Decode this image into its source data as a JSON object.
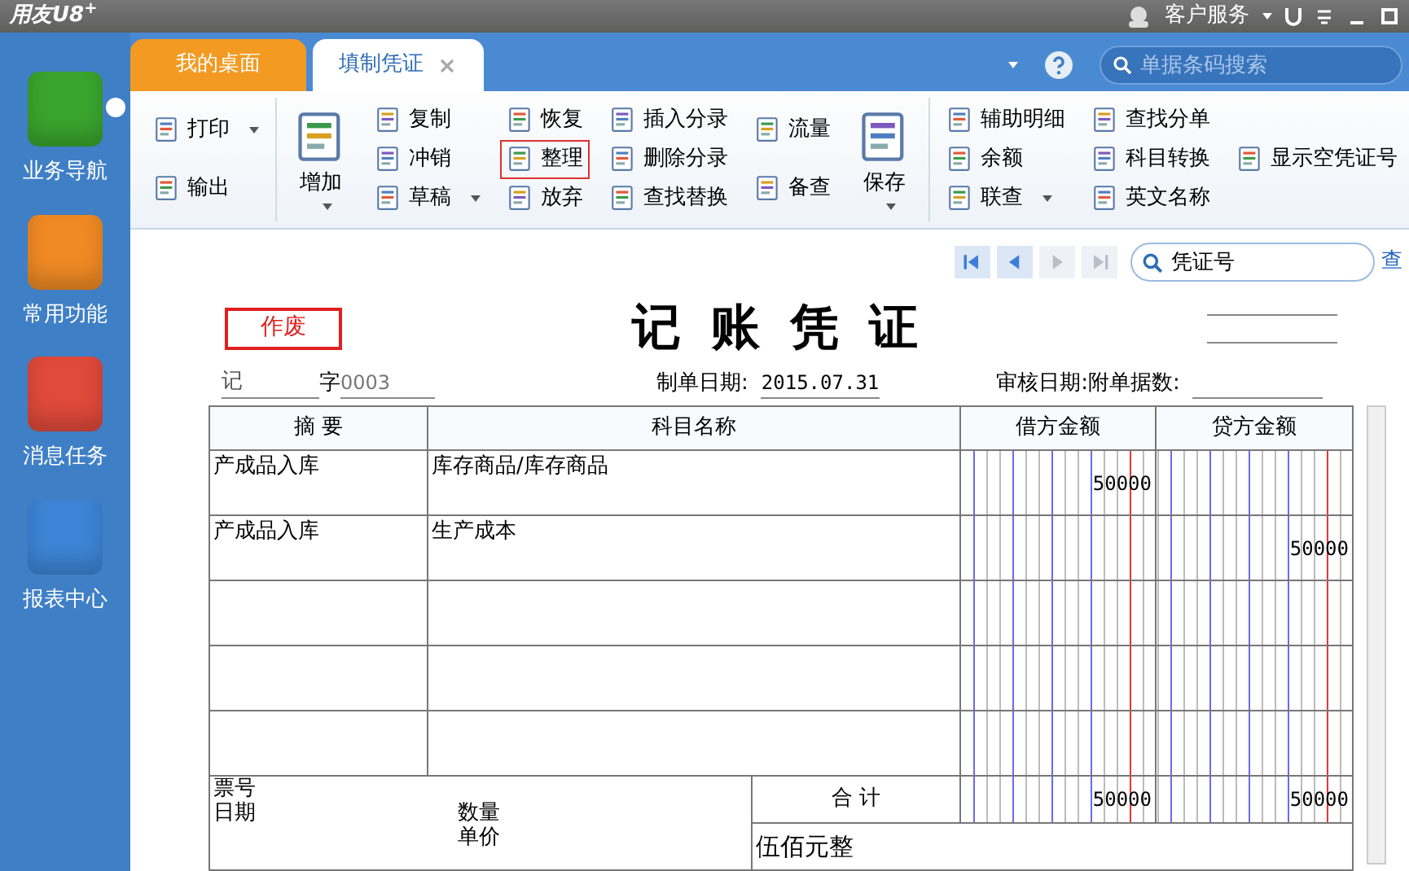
{
  "app_title": "用友U8$^{+}$",
  "title_bar": {
    "service_label": "客户服务"
  },
  "sidebar": {
    "items": [
      {
        "label": "业务导航",
        "color": "#3aa52e",
        "dropdown": true
      },
      {
        "label": "常用功能",
        "color": "#f08a24",
        "dropdown": false
      },
      {
        "label": "消息任务",
        "color": "#e04a3a",
        "dropdown": false
      },
      {
        "label": "报表中心",
        "color": "#3d85d6",
        "dropdown": false
      }
    ]
  },
  "tabs": [
    {
      "label": "我的桌面",
      "selected": false,
      "closable": false
    },
    {
      "label": "填制凭证",
      "selected": true,
      "closable": true
    }
  ],
  "search": {
    "placeholder": "单据条码搜索"
  },
  "toolbar": {
    "groups": [
      {
        "columns": [
          {
            "kind": "stack",
            "items": [
              {
                "label": "打印",
                "dropdown": true,
                "highlighted": false
              },
              {
                "label": "输出",
                "dropdown": false,
                "highlighted": false
              }
            ]
          }
        ]
      },
      {
        "columns": [
          {
            "kind": "large",
            "items": [
              {
                "label": "增加",
                "dropdown": true,
                "highlighted": false
              }
            ]
          },
          {
            "kind": "stack",
            "items": [
              {
                "label": "复制",
                "dropdown": false,
                "highlighted": false
              },
              {
                "label": "冲销",
                "dropdown": false,
                "highlighted": false
              },
              {
                "label": "草稿",
                "dropdown": true,
                "highlighted": false
              }
            ]
          },
          {
            "kind": "stack",
            "items": [
              {
                "label": "恢复",
                "dropdown": false,
                "highlighted": false
              },
              {
                "label": "整理",
                "dropdown": false,
                "highlighted": true
              },
              {
                "label": "放弃",
                "dropdown": false,
                "highlighted": false
              }
            ]
          },
          {
            "kind": "stack",
            "items": [
              {
                "label": "插入分录",
                "dropdown": false,
                "highlighted": false
              },
              {
                "label": "删除分录",
                "dropdown": false,
                "highlighted": false
              },
              {
                "label": "查找替换",
                "dropdown": false,
                "highlighted": false
              }
            ]
          },
          {
            "kind": "stack",
            "items": [
              {
                "label": "流量",
                "dropdown": false,
                "highlighted": false
              },
              {
                "label": "备查",
                "dropdown": false,
                "highlighted": false
              }
            ]
          },
          {
            "kind": "large",
            "items": [
              {
                "label": "保存",
                "dropdown": true,
                "highlighted": false
              }
            ]
          }
        ]
      },
      {
        "columns": [
          {
            "kind": "stack",
            "items": [
              {
                "label": "辅助明细",
                "dropdown": false,
                "highlighted": false
              },
              {
                "label": "余额",
                "dropdown": false,
                "highlighted": false
              },
              {
                "label": "联查",
                "dropdown": true,
                "highlighted": false
              }
            ]
          },
          {
            "kind": "stack",
            "items": [
              {
                "label": "查找分单",
                "dropdown": false,
                "highlighted": false
              },
              {
                "label": "科目转换",
                "dropdown": false,
                "highlighted": false
              },
              {
                "label": "英文名称",
                "dropdown": false,
                "highlighted": false
              }
            ]
          },
          {
            "kind": "stack",
            "items": [
              {
                "label": "显示空凭证号",
                "dropdown": false,
                "highlighted": false
              }
            ]
          }
        ]
      }
    ]
  },
  "voucher_nav": {
    "buttons": [
      {
        "kind": "first",
        "disabled": false
      },
      {
        "kind": "prev",
        "disabled": false
      },
      {
        "kind": "next",
        "disabled": true
      },
      {
        "kind": "last",
        "disabled": true
      }
    ],
    "search_value": "凭证号",
    "query_link": "查"
  },
  "voucher": {
    "stamp": "作废",
    "title": "记 账 凭 证",
    "type": "记",
    "word_label": "字",
    "number": "0003",
    "date_label": "制单日期:",
    "date": "2015.07.31",
    "audit_label": "审核日期:",
    "attachments_label": "附单据数:",
    "columns": [
      "摘 要",
      "科目名称",
      "借方金额",
      "贷方金额"
    ],
    "rows": [
      {
        "summary": "产成品入库",
        "account": "库存商品/库存商品",
        "debit": "50000",
        "credit": ""
      },
      {
        "summary": "产成品入库",
        "account": "生产成本",
        "debit": "",
        "credit": "50000"
      },
      {
        "summary": "",
        "account": "",
        "debit": "",
        "credit": ""
      },
      {
        "summary": "",
        "account": "",
        "debit": "",
        "credit": ""
      },
      {
        "summary": "",
        "account": "",
        "debit": "",
        "credit": ""
      }
    ],
    "footer": {
      "ticket_label": "票号",
      "date_label": "日期",
      "quantity_label": "数量",
      "price_label": "单价",
      "total_label": "合 计",
      "debit_total": "50000",
      "credit_total": "50000",
      "amount_words": "伍佰元整"
    }
  }
}
